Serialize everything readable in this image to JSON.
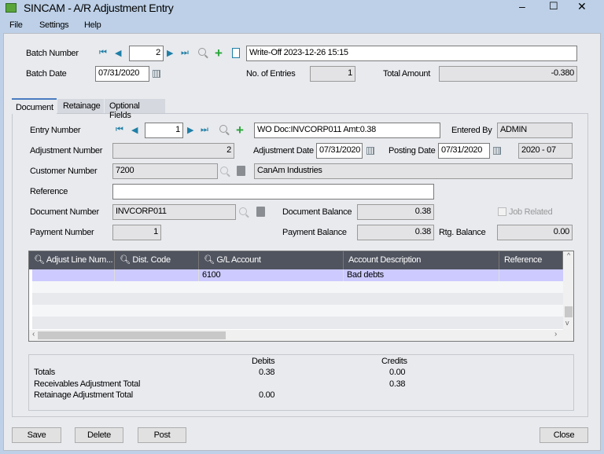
{
  "window": {
    "title": "SINCAM - A/R Adjustment Entry",
    "minimize": "–",
    "maximize": "☐",
    "close": "✕"
  },
  "menu": [
    "File",
    "Settings",
    "Help"
  ],
  "batch": {
    "number_label": "Batch Number",
    "number": "2",
    "description": "Write-Off 2023-12-26 15:15",
    "date_label": "Batch Date",
    "date": "07/31/2020",
    "entries_label": "No. of Entries",
    "entries": "1",
    "total_label": "Total Amount",
    "total": "-0.380"
  },
  "tabs": [
    "Document",
    "Retainage",
    "Optional Fields"
  ],
  "document": {
    "entry_label": "Entry Number",
    "entry": "1",
    "entry_desc": "WO Doc:INVCORP011 Amt:0.38",
    "entered_by_label": "Entered By",
    "entered_by": "ADMIN",
    "adj_num_label": "Adjustment Number",
    "adj_num": "2",
    "adj_date_label": "Adjustment Date",
    "adj_date": "07/31/2020",
    "post_date_label": "Posting Date",
    "post_date": "07/31/2020",
    "period": "2020 - 07",
    "cust_label": "Customer Number",
    "cust": "7200",
    "cust_name": "CanAm Industries",
    "ref_label": "Reference",
    "ref": "",
    "docnum_label": "Document Number",
    "docnum": "INVCORP011",
    "docbal_label": "Document Balance",
    "docbal": "0.38",
    "job_label": "Job Related",
    "paynum_label": "Payment Number",
    "paynum": "1",
    "paybal_label": "Payment Balance",
    "paybal": "0.38",
    "rtg_label": "Rtg. Balance",
    "rtg": "0.00"
  },
  "grid": {
    "columns": [
      "Adjust Line Num...",
      "Dist. Code",
      "G/L Account",
      "Account Description",
      "Reference"
    ],
    "rows": [
      [
        "",
        "",
        "6100",
        "Bad debts",
        ""
      ]
    ]
  },
  "totals": {
    "debits_label": "Debits",
    "credits_label": "Credits",
    "rows": [
      {
        "label": "Totals",
        "debit": "0.38",
        "credit": "0.00"
      },
      {
        "label": "Receivables Adjustment Total",
        "debit": "",
        "credit": "0.38"
      },
      {
        "label": "Retainage Adjustment Total",
        "debit": "0.00",
        "credit": ""
      }
    ]
  },
  "buttons": {
    "save": "Save",
    "delete": "Delete",
    "post": "Post",
    "close": "Close"
  }
}
